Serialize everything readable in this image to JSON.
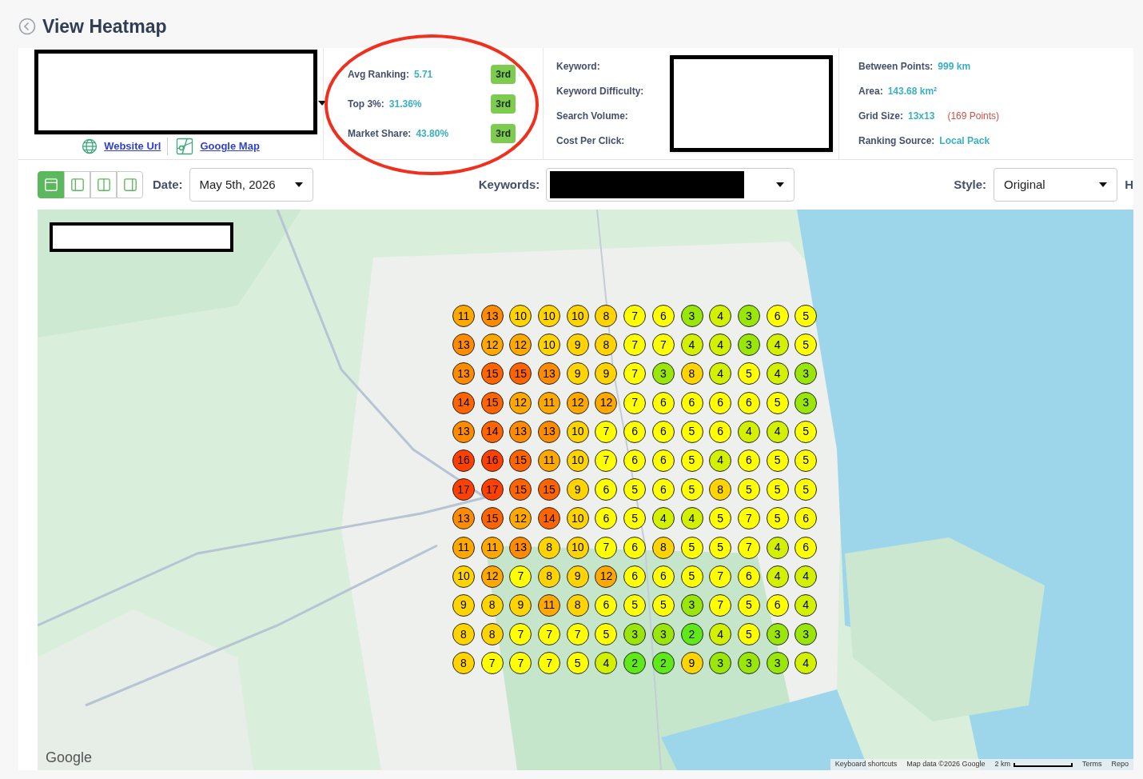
{
  "title": "View Heatmap",
  "links": [
    {
      "kind": "globe",
      "label": "Website Url"
    },
    {
      "kind": "map",
      "label": "Google Map"
    }
  ],
  "stats": [
    {
      "label": "Avg Ranking:",
      "value": "5.71",
      "badge": "3rd"
    },
    {
      "label": "Top 3%:",
      "value": "31.36%",
      "badge": "3rd"
    },
    {
      "label": "Market Share:",
      "value": "43.80%",
      "badge": "3rd"
    }
  ],
  "keyword_labels": [
    "Keyword:",
    "Keyword Difficulty:",
    "Search Volume:",
    "Cost Per Click:"
  ],
  "grid_info": [
    {
      "label": "Between Points:",
      "value": "999 km"
    },
    {
      "label": "Area:",
      "value": "143.68 km²"
    },
    {
      "label": "Grid Size:",
      "value": "13x13",
      "note": "(169 Points)"
    },
    {
      "label": "Ranking Source:",
      "value": "Local Pack"
    }
  ],
  "toolbar": {
    "views": [
      {
        "kind": "full",
        "selected": true
      },
      {
        "kind": "left",
        "selected": false
      },
      {
        "kind": "split",
        "selected": false
      },
      {
        "kind": "right",
        "selected": false
      }
    ],
    "date_label": "Date:",
    "date": "May 5th, 2026",
    "keywords_label": "Keywords:",
    "style_label": "Style:",
    "style": "Original",
    "cut_label": "H"
  },
  "map": {
    "grid": [
      [
        "11",
        "13",
        "10",
        "10",
        "10",
        "8",
        "7",
        "6",
        "3",
        "4",
        "3",
        "6",
        "5"
      ],
      [
        "13",
        "12",
        "12",
        "10",
        "9",
        "8",
        "7",
        "7",
        "4",
        "4",
        "3",
        "4",
        "5"
      ],
      [
        "13",
        "15",
        "15",
        "13",
        "9",
        "9",
        "7",
        "3",
        "8",
        "4",
        "5",
        "4",
        "3"
      ],
      [
        "14",
        "15",
        "12",
        "11",
        "12",
        "12",
        "7",
        "6",
        "6",
        "6",
        "6",
        "5",
        "3"
      ],
      [
        "13",
        "14",
        "13",
        "13",
        "10",
        "7",
        "6",
        "6",
        "5",
        "6",
        "4",
        "4",
        "5"
      ],
      [
        "16",
        "16",
        "15",
        "11",
        "10",
        "7",
        "6",
        "6",
        "5",
        "4",
        "6",
        "5",
        "5"
      ],
      [
        "17",
        "17",
        "15",
        "15",
        "9",
        "6",
        "5",
        "6",
        "5",
        "8",
        "5",
        "5",
        "5"
      ],
      [
        "13",
        "15",
        "12",
        "14",
        "10",
        "6",
        "5",
        "4",
        "4",
        "5",
        "7",
        "5",
        "6"
      ],
      [
        "11",
        "11",
        "13",
        "8",
        "10",
        "7",
        "6",
        "8",
        "5",
        "5",
        "7",
        "4",
        "6"
      ],
      [
        "10",
        "12",
        "7",
        "8",
        "9",
        "12",
        "6",
        "6",
        "5",
        "7",
        "6",
        "4",
        "4"
      ],
      [
        "9",
        "8",
        "9",
        "11",
        "8",
        "6",
        "5",
        "5",
        "3",
        "7",
        "5",
        "6",
        "4"
      ],
      [
        "8",
        "8",
        "7",
        "7",
        "7",
        "5",
        "3",
        "3",
        "2",
        "4",
        "5",
        "3",
        "3"
      ],
      [
        "8",
        "7",
        "7",
        "7",
        "5",
        "4",
        "2",
        "2",
        "9",
        "3",
        "3",
        "3",
        "4"
      ]
    ],
    "logo": "Google",
    "attribution": [
      {
        "kind": "text",
        "label": "Keyboard shortcuts"
      },
      {
        "kind": "text",
        "label": "Map data ©2026 Google"
      },
      {
        "kind": "scale",
        "label": "2 km"
      },
      {
        "kind": "text",
        "label": "Terms"
      },
      {
        "kind": "text",
        "label": "Repo"
      }
    ]
  }
}
